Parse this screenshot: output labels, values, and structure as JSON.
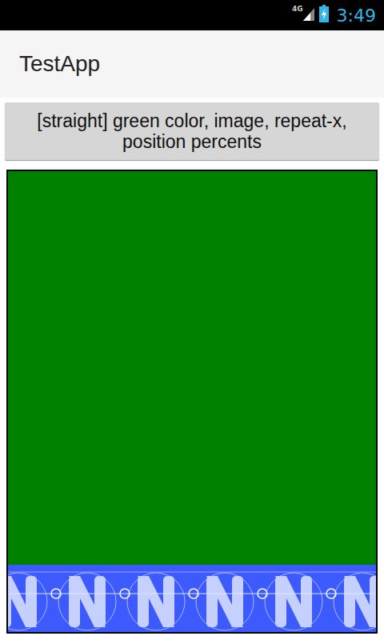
{
  "status_bar": {
    "network": "4G",
    "time": "3:49"
  },
  "app_bar": {
    "title": "TestApp"
  },
  "button": {
    "label": "[straight] green color, image, repeat-x, position percents"
  }
}
